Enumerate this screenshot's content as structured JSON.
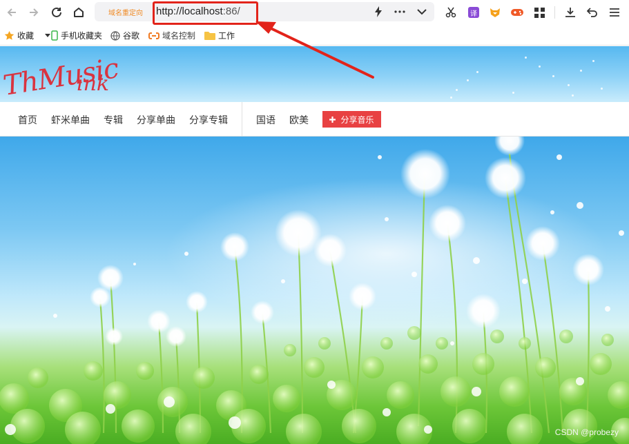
{
  "browser": {
    "address_tag": "域名重定向",
    "url_main": "http://localhost",
    "url_port": ":86/",
    "icons": [
      "back-icon",
      "forward-icon",
      "reload-icon",
      "home-icon",
      "bolt-icon",
      "more-icon",
      "chevron-down-icon",
      "scissors-icon",
      "translate-icon",
      "fox-extension-icon",
      "game-extension-icon",
      "apps-grid-icon",
      "download-icon",
      "undo-icon",
      "menu-icon"
    ],
    "translate_label": "译"
  },
  "bookmarks": [
    {
      "label": "收藏",
      "icon": "star-icon"
    },
    {
      "label": "手机收藏夹",
      "icon": "phone-icon"
    },
    {
      "label": "谷歌",
      "icon": "globe-icon"
    },
    {
      "label": "域名控制",
      "icon": "link-icon"
    },
    {
      "label": "工作",
      "icon": "folder-icon"
    }
  ],
  "site": {
    "logo_line1": "ThMusic",
    "logo_line2": "ink"
  },
  "nav": {
    "items": [
      "首页",
      "虾米单曲",
      "专辑",
      "分享单曲",
      "分享专辑"
    ],
    "lang_items": [
      "国语",
      "欧美"
    ],
    "share_button": "分享音乐"
  },
  "watermark": "CSDN @probezy",
  "colors": {
    "annotation": "#e2231a",
    "share_button": "#e84142",
    "logo": "#d9333f"
  }
}
